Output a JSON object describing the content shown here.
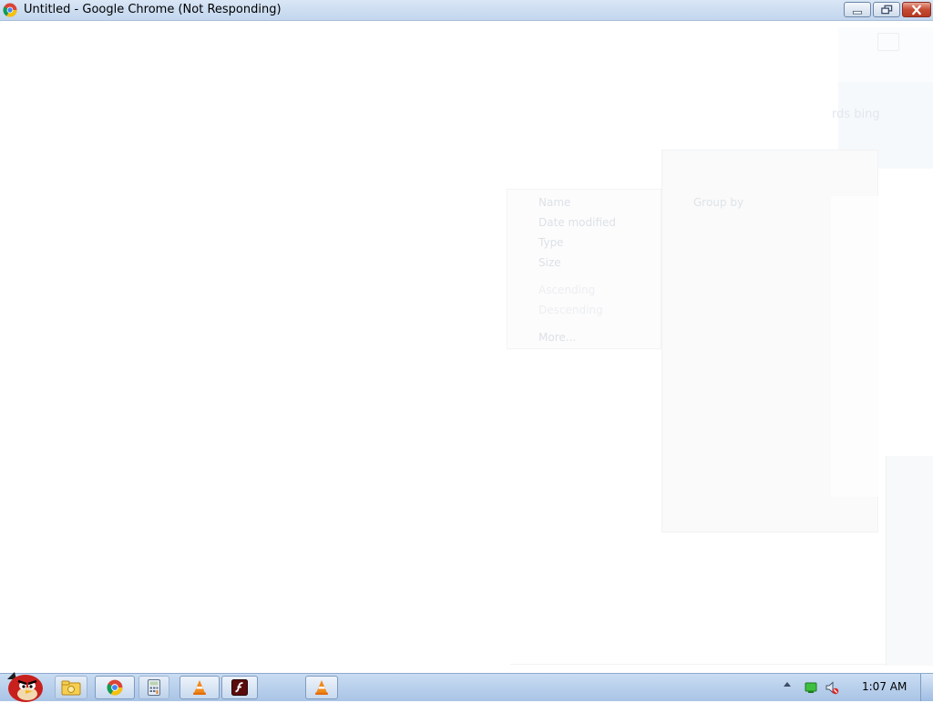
{
  "window": {
    "title": "Untitled - Google Chrome (Not Responding)",
    "icon": "chrome-icon",
    "controls": [
      "minimize-icon",
      "restore-icon",
      "close-icon"
    ]
  },
  "ghost": {
    "breadcrumb_fragment": "rds bing",
    "sort_menu": {
      "items": [
        "Name",
        "Date modified",
        "Type",
        "Size"
      ],
      "order": [
        "Ascending",
        "Descending"
      ],
      "more": "More..."
    },
    "group_panel": {
      "label": "Group by"
    }
  },
  "taskbar": {
    "start": "angry-bird-start-icon",
    "buttons": [
      "explorer-icon",
      "chrome-icon",
      "calculator-icon",
      "vlc-icon",
      "flash-icon",
      "vlc-icon"
    ],
    "tray": [
      "show-hidden-icons-arrow",
      "network-icon",
      "volume-muted-icon"
    ],
    "clock": "1:07 AM"
  },
  "colors": {
    "titlebar": "#c3d6ee",
    "close_button": "#c54a32",
    "taskbar": "#a9c4e6"
  }
}
